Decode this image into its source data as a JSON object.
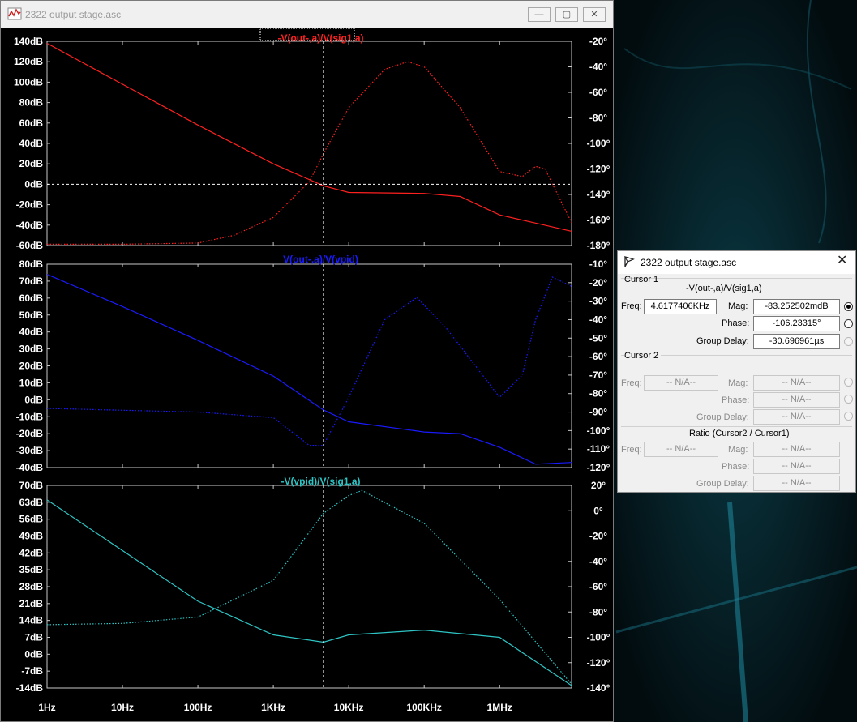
{
  "window": {
    "title": "2322 output stage.asc",
    "buttons": {
      "minimize": "—",
      "maximize": "▢",
      "close": "✕"
    }
  },
  "plots": [
    {
      "title": "-V(out-,a)/V(sig1,a)",
      "color": "#ff2020",
      "y_left_ticks": [
        "140dB",
        "120dB",
        "100dB",
        "80dB",
        "60dB",
        "40dB",
        "20dB",
        "0dB",
        "-20dB",
        "-40dB",
        "-60dB"
      ],
      "y_right_ticks": [
        "-20°",
        "-40°",
        "-60°",
        "-80°",
        "-100°",
        "-120°",
        "-140°",
        "-160°",
        "-180°"
      ]
    },
    {
      "title": "V(out-,a)/V(vpid)",
      "color": "#1a1aff",
      "y_left_ticks": [
        "80dB",
        "70dB",
        "60dB",
        "50dB",
        "40dB",
        "30dB",
        "20dB",
        "10dB",
        "0dB",
        "-10dB",
        "-20dB",
        "-30dB",
        "-40dB"
      ],
      "y_right_ticks": [
        "-10°",
        "-20°",
        "-30°",
        "-40°",
        "-50°",
        "-60°",
        "-70°",
        "-80°",
        "-90°",
        "-100°",
        "-110°",
        "-120°"
      ]
    },
    {
      "title": "-V(vpid)/V(sig1,a)",
      "color": "#2ec4c4",
      "y_left_ticks": [
        "70dB",
        "63dB",
        "56dB",
        "49dB",
        "42dB",
        "35dB",
        "28dB",
        "21dB",
        "14dB",
        "7dB",
        "0dB",
        "-7dB",
        "-14dB"
      ],
      "y_right_ticks": [
        "20°",
        "0°",
        "-20°",
        "-40°",
        "-60°",
        "-80°",
        "-100°",
        "-120°",
        "-140°"
      ]
    }
  ],
  "x_ticks": [
    "1Hz",
    "10Hz",
    "100Hz",
    "1KHz",
    "10KHz",
    "100KHz",
    "1MHz"
  ],
  "chart_data": [
    {
      "type": "line",
      "title": "-V(out-,a)/V(sig1,a)",
      "x_scale": "log",
      "xlim_hz": [
        1,
        9000000
      ],
      "ylim_left_db": [
        -60,
        140
      ],
      "ylim_right_deg": [
        -180,
        -20
      ],
      "grid": false,
      "series": [
        {
          "style": "solid",
          "x_hz": [
            1,
            10,
            100,
            1000,
            4617.74,
            10000,
            100000,
            300000,
            1000000,
            3000000,
            9000000
          ],
          "y_db": [
            138,
            98,
            58,
            20,
            -1.5,
            -8,
            -9,
            -12,
            -30,
            -38,
            -46
          ]
        },
        {
          "style": "dotted",
          "x_hz": [
            1,
            10,
            100,
            300,
            1000,
            3000,
            4617.74,
            10000,
            30000,
            60000,
            100000,
            300000,
            1000000,
            2000000,
            3000000,
            4000000,
            9000000
          ],
          "y_deg": [
            -179,
            -179,
            -178,
            -172,
            -158,
            -130,
            -108,
            -72,
            -42,
            -36,
            -40,
            -72,
            -122,
            -126,
            -118,
            -120,
            -162
          ]
        }
      ],
      "hcursor_db": 0
    },
    {
      "type": "line",
      "title": "V(out-,a)/V(vpid)",
      "x_scale": "log",
      "xlim_hz": [
        1,
        9000000
      ],
      "ylim_left_db": [
        -40,
        80
      ],
      "ylim_right_deg": [
        -120,
        -10
      ],
      "grid": false,
      "series": [
        {
          "style": "solid",
          "x_hz": [
            1,
            10,
            100,
            1000,
            4617.74,
            10000,
            100000,
            300000,
            1000000,
            3000000,
            9000000
          ],
          "y_db": [
            74,
            55,
            35,
            14,
            -6,
            -13,
            -19,
            -20,
            -28,
            -38,
            -37
          ]
        },
        {
          "style": "dotted",
          "x_hz": [
            1,
            10,
            100,
            1000,
            3000,
            4617.74,
            10000,
            30000,
            80000,
            200000,
            1000000,
            2000000,
            3000000,
            5000000,
            9000000
          ],
          "y_deg": [
            -88,
            -89,
            -90,
            -93,
            -108,
            -108,
            -82,
            -40,
            -28,
            -45,
            -82,
            -70,
            -40,
            -17,
            -22
          ]
        }
      ]
    },
    {
      "type": "line",
      "title": "-V(vpid)/V(sig1,a)",
      "x_scale": "log",
      "xlim_hz": [
        1,
        9000000
      ],
      "ylim_left_db": [
        -14,
        70
      ],
      "ylim_right_deg": [
        -140,
        20
      ],
      "grid": false,
      "series": [
        {
          "style": "solid",
          "x_hz": [
            1,
            10,
            100,
            1000,
            4617.74,
            10000,
            100000,
            1000000,
            9000000
          ],
          "y_db": [
            64,
            43,
            22,
            8,
            5,
            8,
            10,
            7,
            -13
          ]
        },
        {
          "style": "dotted",
          "x_hz": [
            1,
            10,
            100,
            1000,
            4617.74,
            10000,
            15000,
            100000,
            1000000,
            9000000
          ],
          "y_deg": [
            -90,
            -89,
            -84,
            -55,
            -2,
            12,
            16,
            -10,
            -70,
            -137
          ]
        }
      ]
    }
  ],
  "cursor_dialog": {
    "title": "2322 output stage.asc",
    "close": "✕",
    "cursor1": {
      "heading": "Cursor 1",
      "trace": "-V(out-,a)/V(sig1,a)",
      "freq_label": "Freq:",
      "freq": "4.6177406KHz",
      "mag_label": "Mag:",
      "mag": "-83.252502mdB",
      "phase_label": "Phase:",
      "phase": "-106.23315°",
      "group_delay_label": "Group Delay:",
      "group_delay": "-30.696961µs"
    },
    "cursor2": {
      "heading": "Cursor 2",
      "freq_label": "Freq:",
      "freq": "-- N/A--",
      "mag_label": "Mag:",
      "mag": "-- N/A--",
      "phase_label": "Phase:",
      "phase": "-- N/A--",
      "group_delay_label": "Group Delay:",
      "group_delay": "-- N/A--"
    },
    "ratio": {
      "heading": "Ratio (Cursor2 / Cursor1)",
      "freq_label": "Freq:",
      "freq": "-- N/A--",
      "mag_label": "Mag:",
      "mag": "-- N/A--",
      "phase_label": "Phase:",
      "phase": "-- N/A--",
      "group_delay_label": "Group Delay:",
      "group_delay": "-- N/A--"
    }
  }
}
